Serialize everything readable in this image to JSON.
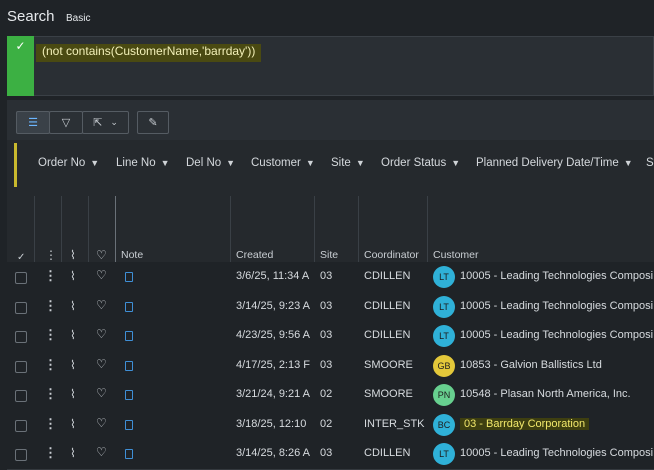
{
  "header": {
    "title": "Search",
    "mode": "Basic"
  },
  "query": {
    "text": "(not contains(CustomerName,'barrday'))"
  },
  "toolbar": {
    "list_icon": "list-icon",
    "filter_icon": "filter-icon",
    "export_icon": "export-icon",
    "edit_icon": "pencil-icon"
  },
  "filters": [
    {
      "label": "Order No"
    },
    {
      "label": "Line No"
    },
    {
      "label": "Del No"
    },
    {
      "label": "Customer"
    },
    {
      "label": "Site"
    },
    {
      "label": "Order Status"
    },
    {
      "label": "Planned Delivery Date/Time"
    },
    {
      "label": "St"
    }
  ],
  "columns": {
    "note": "Note",
    "created": "Created",
    "site": "Site",
    "coordinator": "Coordinator",
    "customer": "Customer"
  },
  "rows": [
    {
      "created": "3/6/25, 11:34 A",
      "site": "03",
      "coordinator": "CDILLEN",
      "initials": "LT",
      "badge_color": "#2fb1d8",
      "customer": "10005 - Leading Technologies Composi",
      "highlight": false
    },
    {
      "created": "3/14/25, 9:23 A",
      "site": "03",
      "coordinator": "CDILLEN",
      "initials": "LT",
      "badge_color": "#2fb1d8",
      "customer": "10005 - Leading Technologies Composi",
      "highlight": false
    },
    {
      "created": "4/23/25, 9:56 A",
      "site": "03",
      "coordinator": "CDILLEN",
      "initials": "LT",
      "badge_color": "#2fb1d8",
      "customer": "10005 - Leading Technologies Composi",
      "highlight": false
    },
    {
      "created": "4/17/25, 2:13 F",
      "site": "03",
      "coordinator": "SMOORE",
      "initials": "GB",
      "badge_color": "#e3c83a",
      "customer": "10853 - Galvion Ballistics Ltd",
      "highlight": false
    },
    {
      "created": "3/21/24, 9:21 A",
      "site": "02",
      "coordinator": "SMOORE",
      "initials": "PN",
      "badge_color": "#67d08f",
      "customer": "10548 - Plasan North America, Inc.",
      "highlight": false
    },
    {
      "created": "3/18/25, 12:10",
      "site": "02",
      "coordinator": "INTER_STK",
      "initials": "BC",
      "badge_color": "#2fb1d8",
      "customer": "03 - Barrday Corporation",
      "highlight": true
    },
    {
      "created": "3/14/25, 8:26 A",
      "site": "03",
      "coordinator": "CDILLEN",
      "initials": "LT",
      "badge_color": "#2fb1d8",
      "customer": "10005 - Leading Technologies Composi",
      "highlight": false
    }
  ]
}
